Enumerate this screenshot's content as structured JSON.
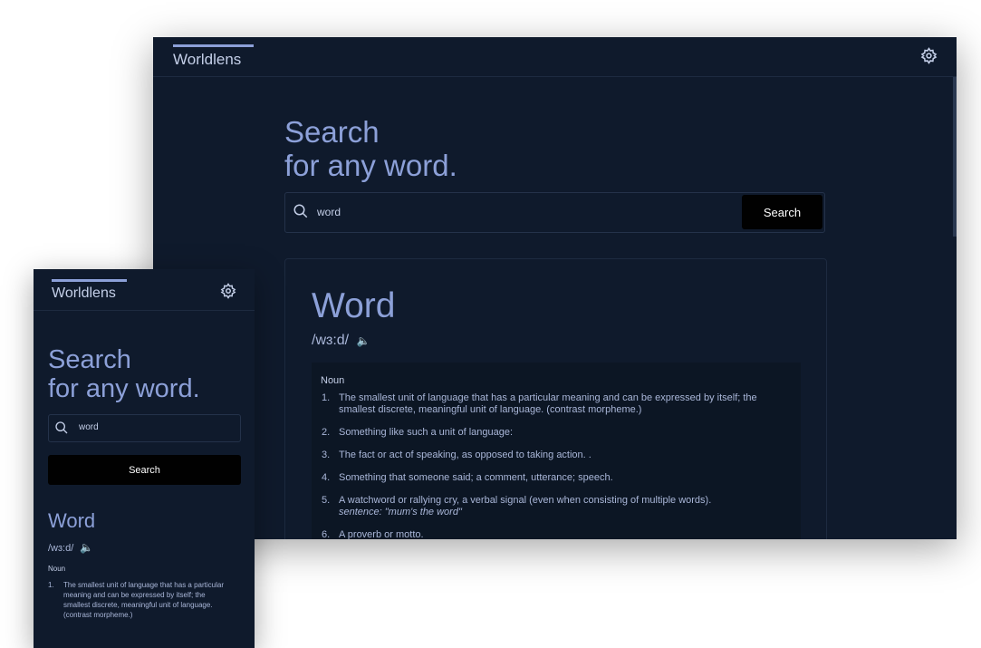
{
  "app": {
    "brand": "Worldlens"
  },
  "hero": {
    "line1": "Search",
    "line2": "for any word."
  },
  "search": {
    "value": "word",
    "button_label": "Search"
  },
  "result": {
    "word": "Word",
    "phonetic": "/wɜ:d/",
    "speaker_icon": "🔈",
    "part_of_speech": "Noun",
    "definitions": [
      {
        "num": "1.",
        "text": "The smallest unit of language that has a particular meaning and can be expressed by itself; the smallest discrete, meaningful unit of language. (contrast morpheme.)"
      },
      {
        "num": "2.",
        "text": "Something like such a unit of language:"
      },
      {
        "num": "3.",
        "text": "The fact or act of speaking, as opposed to taking action. ."
      },
      {
        "num": "4.",
        "text": "Something that someone said; a comment, utterance; speech."
      },
      {
        "num": "5.",
        "text": "A watchword or rallying cry, a verbal signal (even when consisting of multiple words).",
        "example": "sentence: \"mum's the word\""
      },
      {
        "num": "6.",
        "text": "A proverb or motto."
      }
    ]
  },
  "icons": {
    "settings": "gear-icon",
    "search": "search-icon",
    "audio": "speaker-icon"
  },
  "colors": {
    "background": "#0f1a2c",
    "accent": "#8ca0d8",
    "text": "#c4cfe8",
    "button": "#010101"
  }
}
